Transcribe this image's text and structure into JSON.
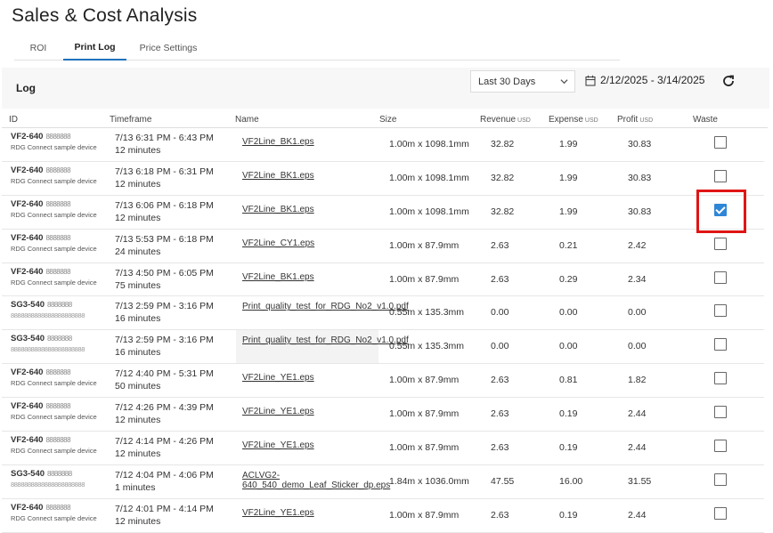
{
  "page": {
    "title": "Sales & Cost Analysis"
  },
  "tabs": [
    {
      "label": "ROI",
      "active": false
    },
    {
      "label": "Print Log",
      "active": true
    },
    {
      "label": "Price Settings",
      "active": false
    }
  ],
  "log": {
    "label": "Log",
    "range_select": "Last 30 Days",
    "date_range": "2/12/2025 - 3/14/2025"
  },
  "table": {
    "headers": {
      "id": "ID",
      "timeframe": "Timeframe",
      "name": "Name",
      "size": "Size",
      "revenue": "Revenue",
      "expense": "Expense",
      "profit": "Profit",
      "unit": "USD",
      "waste": "Waste"
    },
    "rows": [
      {
        "id": "VF2-640",
        "id_mask": "8888888",
        "device": "RDG Connect sample device",
        "time": "7/13 6:31 PM - 6:43 PM",
        "duration": "12 minutes",
        "name": "VF2Line_BK1.eps",
        "size": "1.00m x 1098.1mm",
        "revenue": "32.82",
        "expense": "1.99",
        "profit": "30.83",
        "waste": false
      },
      {
        "id": "VF2-640",
        "id_mask": "8888888",
        "device": "RDG Connect sample device",
        "time": "7/13 6:18 PM - 6:31 PM",
        "duration": "12 minutes",
        "name": "VF2Line_BK1.eps",
        "size": "1.00m x 1098.1mm",
        "revenue": "32.82",
        "expense": "1.99",
        "profit": "30.83",
        "waste": false
      },
      {
        "id": "VF2-640",
        "id_mask": "8888888",
        "device": "RDG Connect sample device",
        "time": "7/13 6:06 PM - 6:18 PM",
        "duration": "12 minutes",
        "name": "VF2Line_BK1.eps",
        "size": "1.00m x 1098.1mm",
        "revenue": "32.82",
        "expense": "1.99",
        "profit": "30.83",
        "waste": true
      },
      {
        "id": "VF2-640",
        "id_mask": "8888888",
        "device": "RDG Connect sample device",
        "time": "7/13 5:53 PM - 6:18 PM",
        "duration": "24 minutes",
        "name": "VF2Line_CY1.eps",
        "size": "1.00m x 87.9mm",
        "revenue": "2.63",
        "expense": "0.21",
        "profit": "2.42",
        "waste": false
      },
      {
        "id": "VF2-640",
        "id_mask": "8888888",
        "device": "RDG Connect sample device",
        "time": "7/13 4:50 PM - 6:05 PM",
        "duration": "75 minutes",
        "name": "VF2Line_BK1.eps",
        "size": "1.00m x 87.9mm",
        "revenue": "2.63",
        "expense": "0.29",
        "profit": "2.34",
        "waste": false
      },
      {
        "id": "SG3-540",
        "id_mask": "8888888",
        "device": "8888888888888888888888",
        "time": "7/13 2:59 PM - 3:16 PM",
        "duration": "16 minutes",
        "name": "Print_quality_test_for_RDG_No2_v1.0.pdf",
        "size": "0.55m x 135.3mm",
        "revenue": "0.00",
        "expense": "0.00",
        "profit": "0.00",
        "waste": false
      },
      {
        "id": "SG3-540",
        "id_mask": "8888888",
        "device": "8888888888888888888888",
        "time": "7/13 2:59 PM - 3:16 PM",
        "duration": "16 minutes",
        "name": "Print_quality_test_for_RDG_No2_v1.0.pdf",
        "size": "0.55m x 135.3mm",
        "revenue": "0.00",
        "expense": "0.00",
        "profit": "0.00",
        "waste": false
      },
      {
        "id": "VF2-640",
        "id_mask": "8888888",
        "device": "RDG Connect sample device",
        "time": "7/12 4:40 PM - 5:31 PM",
        "duration": "50 minutes",
        "name": "VF2Line_YE1.eps",
        "size": "1.00m x 87.9mm",
        "revenue": "2.63",
        "expense": "0.81",
        "profit": "1.82",
        "waste": false
      },
      {
        "id": "VF2-640",
        "id_mask": "8888888",
        "device": "RDG Connect sample device",
        "time": "7/12 4:26 PM - 4:39 PM",
        "duration": "12 minutes",
        "name": "VF2Line_YE1.eps",
        "size": "1.00m x 87.9mm",
        "revenue": "2.63",
        "expense": "0.19",
        "profit": "2.44",
        "waste": false
      },
      {
        "id": "VF2-640",
        "id_mask": "8888888",
        "device": "RDG Connect sample device",
        "time": "7/12 4:14 PM - 4:26 PM",
        "duration": "12 minutes",
        "name": "VF2Line_YE1.eps",
        "size": "1.00m x 87.9mm",
        "revenue": "2.63",
        "expense": "0.19",
        "profit": "2.44",
        "waste": false
      },
      {
        "id": "SG3-540",
        "id_mask": "8888888",
        "device": "8888888888888888888888",
        "time": "7/12 4:04 PM - 4:06 PM",
        "duration": "1  minutes",
        "name": "ACLVG2-640_540_demo_Leaf_Sticker_dp.eps",
        "size": "1.84m x 1036.0mm",
        "revenue": "47.55",
        "expense": "16.00",
        "profit": "31.55",
        "waste": false
      },
      {
        "id": "VF2-640",
        "id_mask": "8888888",
        "device": "RDG Connect sample device",
        "time": "7/12 4:01 PM - 4:14 PM",
        "duration": "12 minutes",
        "name": "VF2Line_YE1.eps",
        "size": "1.00m x 87.9mm",
        "revenue": "2.63",
        "expense": "0.19",
        "profit": "2.44",
        "waste": false
      }
    ]
  },
  "icons": {
    "calendar": "calendar-icon",
    "refresh": "refresh-icon",
    "chevron": "chevron-down-icon"
  },
  "colors": {
    "accent": "#1e73be",
    "checkbox_checked": "#2f86d6",
    "highlight": "#e01515"
  }
}
